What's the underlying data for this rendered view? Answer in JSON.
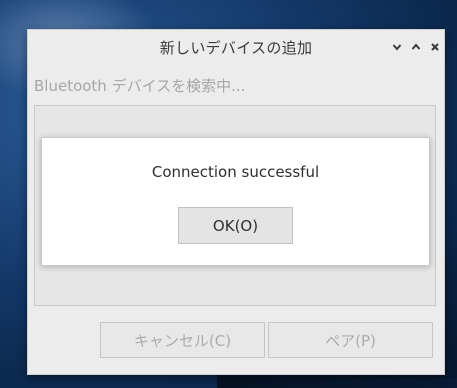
{
  "window": {
    "title": "新しいデバイスの追加",
    "controls": {
      "minimize_icon": "chevron-down-icon",
      "maximize_icon": "chevron-up-icon",
      "close_icon": "close-icon"
    }
  },
  "search_status": "Bluetooth デバイスを検索中...",
  "buttons": {
    "cancel_label": "キャンセル(C)",
    "pair_label": "ペア(P)"
  },
  "dialog": {
    "message": "Connection successful",
    "ok_label": "OK(O)"
  }
}
